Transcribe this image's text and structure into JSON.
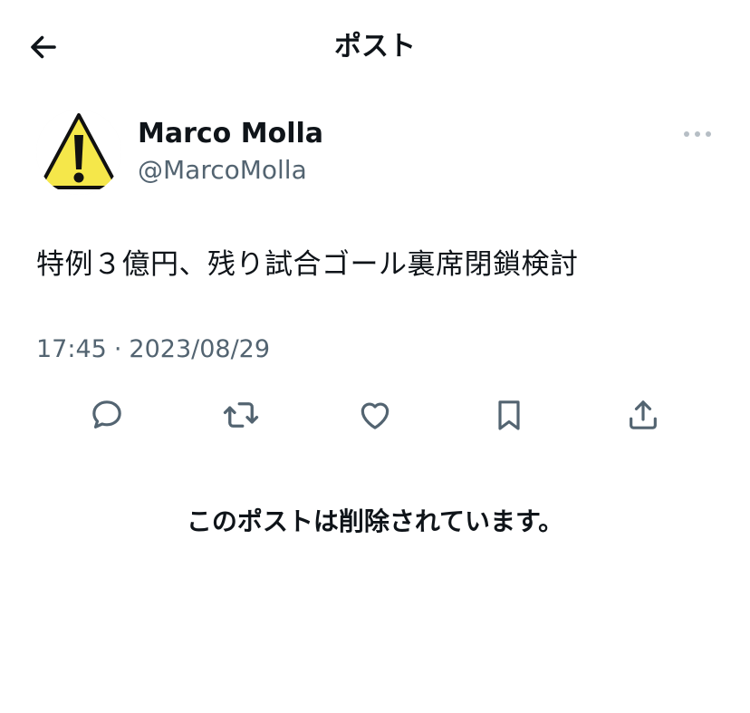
{
  "header": {
    "title": "ポスト",
    "back_icon": "arrow-left-icon"
  },
  "author": {
    "display_name": "Marco Molla",
    "handle": "@MarcoMolla",
    "avatar_icon": "warning-sign-icon",
    "avatar_colors": {
      "fill": "#f5e74a",
      "stroke": "#111111"
    }
  },
  "more_icon": "more-horizontal-icon",
  "post": {
    "text": "特例３億円、残り試合ゴール裏席閉鎖検討",
    "time": "17:45",
    "separator": "·",
    "date": "2023/08/29"
  },
  "actions": [
    {
      "name": "reply-icon"
    },
    {
      "name": "repost-icon"
    },
    {
      "name": "like-icon"
    },
    {
      "name": "bookmark-icon"
    },
    {
      "name": "share-icon"
    }
  ],
  "notice": {
    "text": "このポストは削除されています。"
  },
  "colors": {
    "primary_text": "#0f1419",
    "secondary_text": "#536471",
    "icon": "#536471",
    "background": "#ffffff"
  }
}
